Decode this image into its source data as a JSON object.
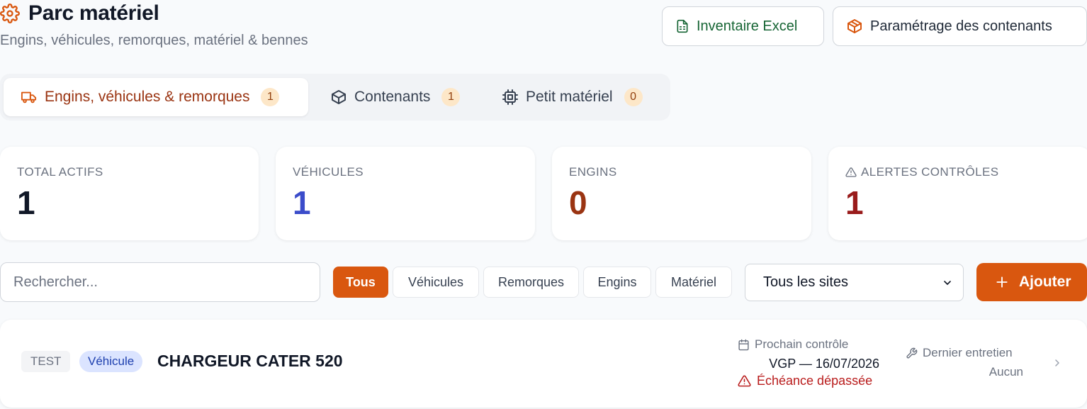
{
  "header": {
    "title": "Parc matériel",
    "subtitle": "Engins, véhicules, remorques, matériel & bennes",
    "btn_excel": "Inventaire Excel",
    "btn_param": "Paramétrage des contenants"
  },
  "tabs": [
    {
      "label": "Engins, véhicules & remorques",
      "count": "1",
      "active": true
    },
    {
      "label": "Contenants",
      "count": "1"
    },
    {
      "label": "Petit matériel",
      "count": "0"
    }
  ],
  "stats": [
    {
      "label": "TOTAL ACTIFS",
      "value": "1",
      "color": "#111827"
    },
    {
      "label": "VÉHICULES",
      "value": "1",
      "color": "#3b4cca"
    },
    {
      "label": "ENGINS",
      "value": "0",
      "color": "#9a3412"
    },
    {
      "label": "ALERTES CONTRÔLES",
      "value": "1",
      "color": "#991b1b"
    }
  ],
  "filters": {
    "search_placeholder": "Rechercher...",
    "chips": [
      "Tous",
      "Véhicules",
      "Remorques",
      "Engins",
      "Matériel"
    ],
    "active_chip": "Tous",
    "site_select": "Tous les sites",
    "add_label": "Ajouter"
  },
  "assets": [
    {
      "site": "TEST",
      "type": "Véhicule",
      "name": "CHARGEUR CATER 520",
      "next_label": "Prochain contrôle",
      "next_value": "VGP — 16/07/2026",
      "overdue": "Échéance dépassée",
      "last_label": "Dernier entretien",
      "last_value": "Aucun"
    }
  ],
  "colors": {
    "accent": "#d9570f",
    "excel": "#166534",
    "danger": "#b91c1c"
  }
}
